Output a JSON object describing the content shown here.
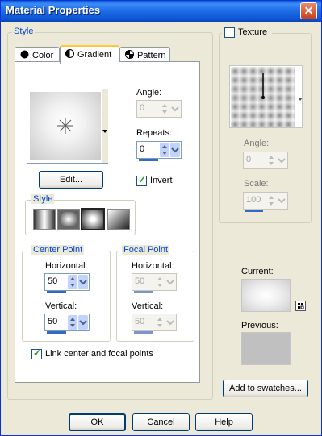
{
  "window": {
    "title": "Material Properties",
    "close_glyph": "✕"
  },
  "style_group": {
    "label": "Style",
    "tabs": [
      {
        "label": "Color",
        "icon": "circle-icon"
      },
      {
        "label": "Gradient",
        "icon": "half-circle-icon"
      },
      {
        "label": "Pattern",
        "icon": "pattern-icon"
      }
    ],
    "active_tab": "Gradient"
  },
  "gradient": {
    "angle_label": "Angle:",
    "angle_value": "0",
    "repeats_label": "Repeats:",
    "repeats_value": "0",
    "edit_button": "Edit...",
    "invert_label": "Invert",
    "invert_checked": true,
    "style_label": "Style",
    "style_options": [
      "linear-style-icon",
      "rectangular-style-icon",
      "sunburst-style-icon",
      "radial-style-icon"
    ],
    "style_selected": 2,
    "center_point": {
      "label": "Center Point",
      "horizontal_label": "Horizontal:",
      "horizontal_value": "50",
      "vertical_label": "Vertical:",
      "vertical_value": "50"
    },
    "focal_point": {
      "label": "Focal Point",
      "horizontal_label": "Horizontal:",
      "horizontal_value": "50",
      "vertical_label": "Vertical:",
      "vertical_value": "50"
    },
    "link_label": "Link center and focal points",
    "link_checked": true
  },
  "texture": {
    "label": "Texture",
    "checked": false,
    "angle_label": "Angle:",
    "angle_value": "0",
    "scale_label": "Scale:",
    "scale_value": "100"
  },
  "preview": {
    "current_label": "Current:",
    "previous_label": "Previous:"
  },
  "add_swatches_button": "Add to swatches...",
  "buttons": {
    "ok": "OK",
    "cancel": "Cancel",
    "help": "Help"
  }
}
